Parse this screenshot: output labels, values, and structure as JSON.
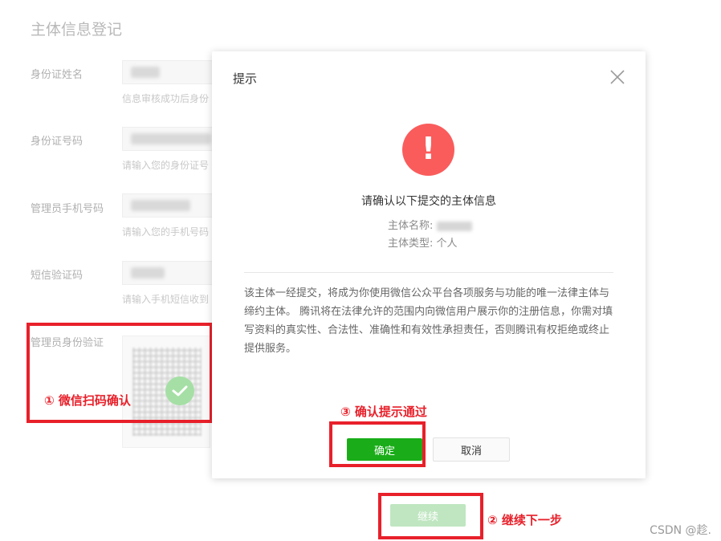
{
  "page": {
    "title": "主体信息登记",
    "fields": [
      {
        "label": "身份证姓名",
        "hint": "信息审核成功后身份"
      },
      {
        "label": "身份证号码",
        "hint": "请输入您的身份证号"
      },
      {
        "label": "管理员手机号码",
        "hint": "请输入您的手机号码"
      },
      {
        "label": "短信验证码",
        "hint": "请输入手机短信收到"
      },
      {
        "label": "管理员身份验证"
      }
    ],
    "next_label": "继续"
  },
  "annotations": {
    "step1": "① 微信扫码确认",
    "step2": "② 继续下一步",
    "step3": "③ 确认提示通过"
  },
  "dialog": {
    "title": "提示",
    "heading": "请确认以下提交的主体信息",
    "name_label": "主体名称:",
    "type_label": "主体类型:",
    "type_value": "个人",
    "agreement": "该主体一经提交，将成为你使用微信公众平台各项服务与功能的唯一法律主体与缔约主体。 腾讯将在法律允许的范围内向微信用户展示你的注册信息，你需对填写资料的真实性、合法性、准确性和有效性承担责任，否则腾讯有权拒绝或终止提供服务。",
    "confirm_label": "确定",
    "cancel_label": "取消"
  },
  "watermark": "CSDN @趁."
}
